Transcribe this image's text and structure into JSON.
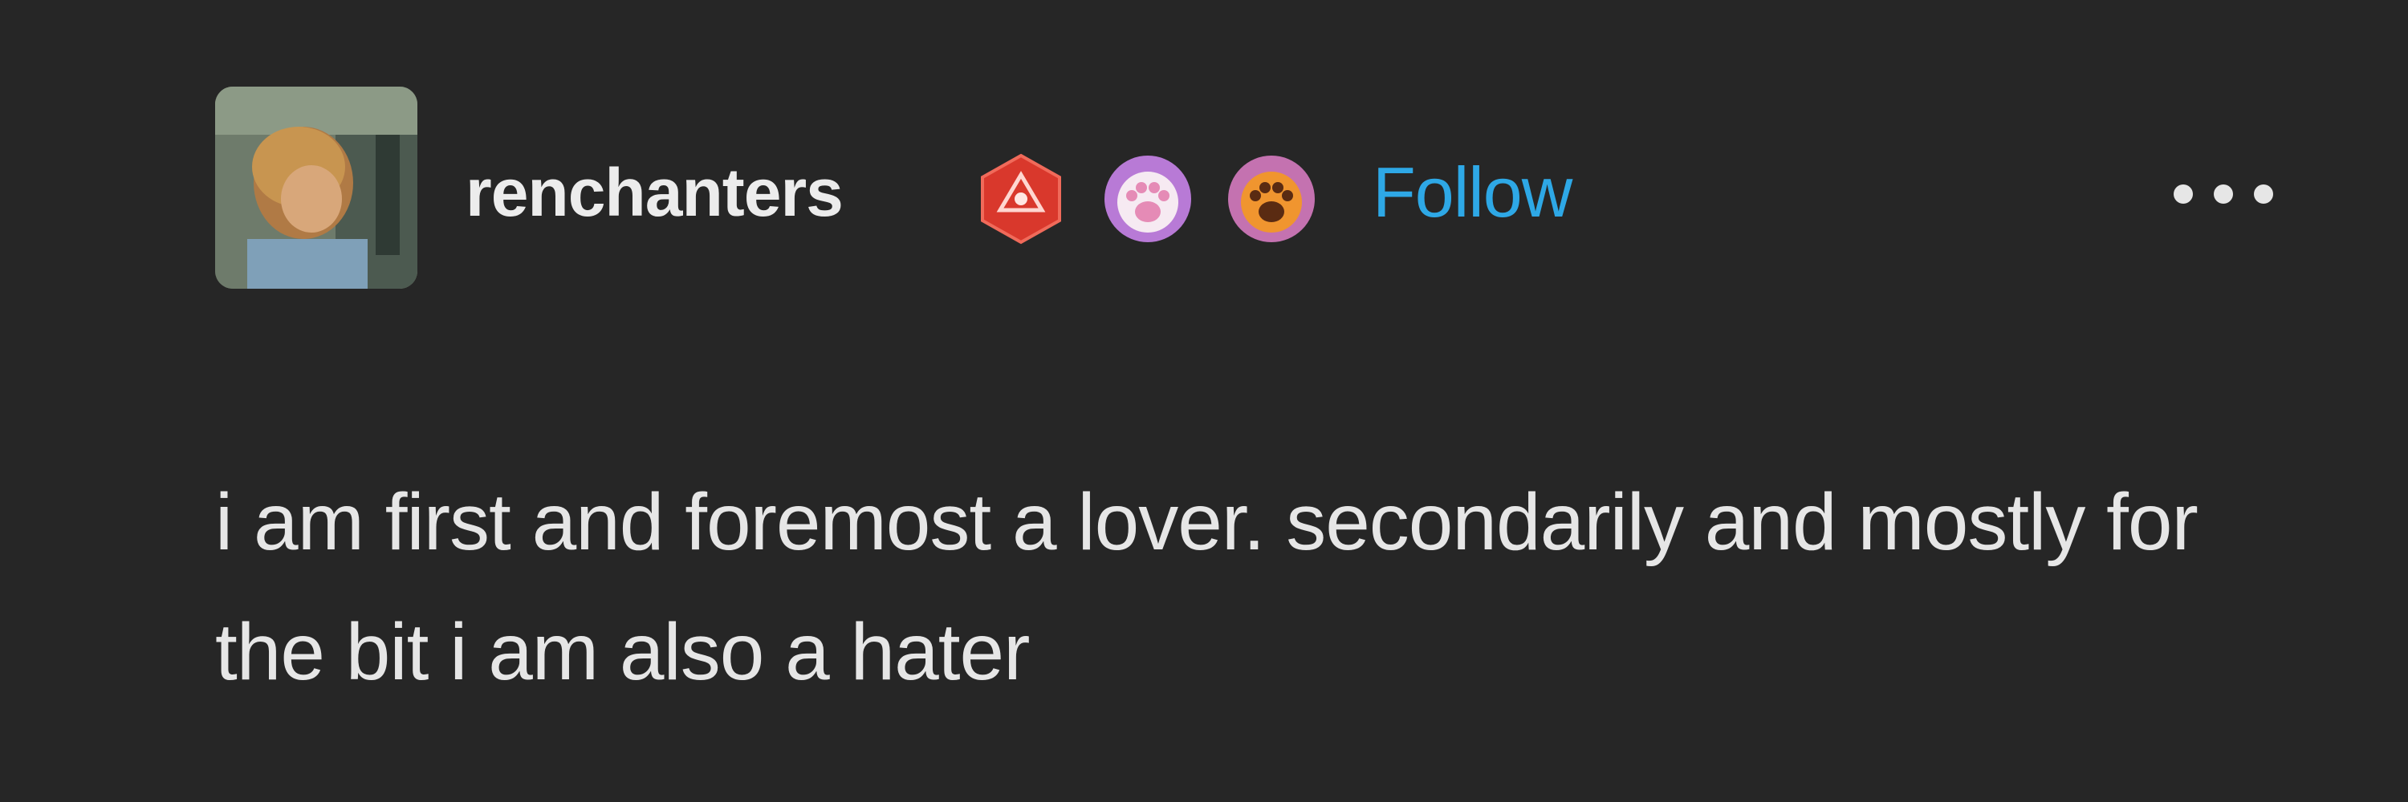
{
  "post": {
    "author": {
      "username": "renchanters",
      "avatar_icon": "avatar-image",
      "badges": [
        {
          "icon": "d20-dice-badge-icon",
          "color": "#d9382c"
        },
        {
          "icon": "pink-paw-badge-icon",
          "color": "#b87ad6"
        },
        {
          "icon": "orange-paw-badge-icon",
          "color": "#c472b0"
        }
      ]
    },
    "follow_label": "Follow",
    "more_icon": "more-options-icon",
    "body": "i am first and foremost a lover. secondarily and mostly for the bit i am also a hater"
  },
  "colors": {
    "background": "#262626",
    "text": "#e8e8e8",
    "accent": "#2ea8e6"
  }
}
